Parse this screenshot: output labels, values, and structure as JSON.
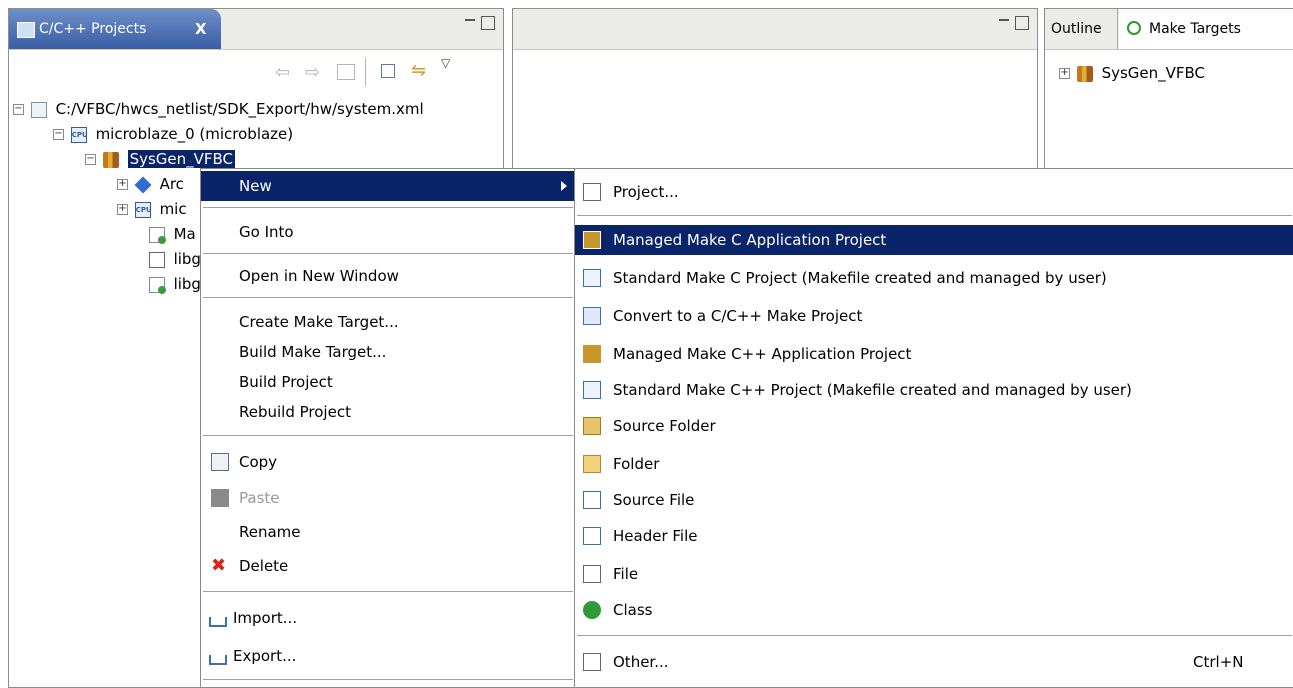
{
  "projects_view": {
    "tab_label": "C/C++ Projects",
    "close_glyph": "X",
    "tree": [
      {
        "label": "C:/VFBC/hwcs_netlist/SDK_Export/hw/system.xml",
        "expander": "−"
      },
      {
        "label": "microblaze_0 (microblaze)",
        "expander": "−"
      },
      {
        "label": "SysGen_VFBC",
        "expander": "−"
      },
      {
        "label": "Arc",
        "expander": "+"
      },
      {
        "label": "mic",
        "expander": "+"
      },
      {
        "label": "Ma"
      },
      {
        "label": "libg"
      },
      {
        "label": "libg"
      }
    ]
  },
  "right_view": {
    "tabs": [
      {
        "label": "Outline"
      },
      {
        "label": "Make Targets"
      }
    ],
    "tree": [
      {
        "label": "SysGen_VFBC",
        "expander": "+"
      }
    ]
  },
  "context_menu": {
    "items": [
      {
        "label": "New",
        "submenu": true,
        "selected": true
      },
      {
        "label": "Go Into"
      },
      {
        "label": "Open in New Window"
      },
      {
        "label": "Create Make Target..."
      },
      {
        "label": "Build Make Target..."
      },
      {
        "label": "Build Project"
      },
      {
        "label": "Rebuild Project"
      },
      {
        "label": "Copy",
        "icon": "copy-icon"
      },
      {
        "label": "Paste",
        "icon": "paste-icon",
        "disabled": true
      },
      {
        "label": "Rename"
      },
      {
        "label": "Delete",
        "icon": "delete-icon"
      },
      {
        "label": "Import...",
        "icon": "import-icon"
      },
      {
        "label": "Export...",
        "icon": "export-icon"
      }
    ]
  },
  "new_submenu": {
    "items": [
      {
        "label": "Project...",
        "icon": "new-project-icon"
      },
      {
        "label": "Managed Make C Application Project",
        "icon": "managed-make-c-icon",
        "selected": true
      },
      {
        "label": "Standard Make C Project (Makefile created and managed by user)",
        "icon": "standard-make-c-icon"
      },
      {
        "label": "Convert to a C/C++ Make Project",
        "icon": "convert-project-icon"
      },
      {
        "label": "Managed Make C++ Application Project",
        "icon": "managed-make-cpp-icon"
      },
      {
        "label": "Standard Make C++ Project (Makefile created and managed by user)",
        "icon": "standard-make-cpp-icon"
      },
      {
        "label": "Source Folder",
        "icon": "source-folder-icon"
      },
      {
        "label": "Folder",
        "icon": "folder-icon"
      },
      {
        "label": "Source File",
        "icon": "source-file-icon"
      },
      {
        "label": "Header File",
        "icon": "header-file-icon"
      },
      {
        "label": "File",
        "icon": "file-icon"
      },
      {
        "label": "Class",
        "icon": "class-icon"
      },
      {
        "label": "Other...",
        "icon": "other-icon",
        "shortcut": "Ctrl+N"
      }
    ]
  },
  "colors": {
    "selection": "#0a246a",
    "active_tab": "#3a5ea6"
  }
}
